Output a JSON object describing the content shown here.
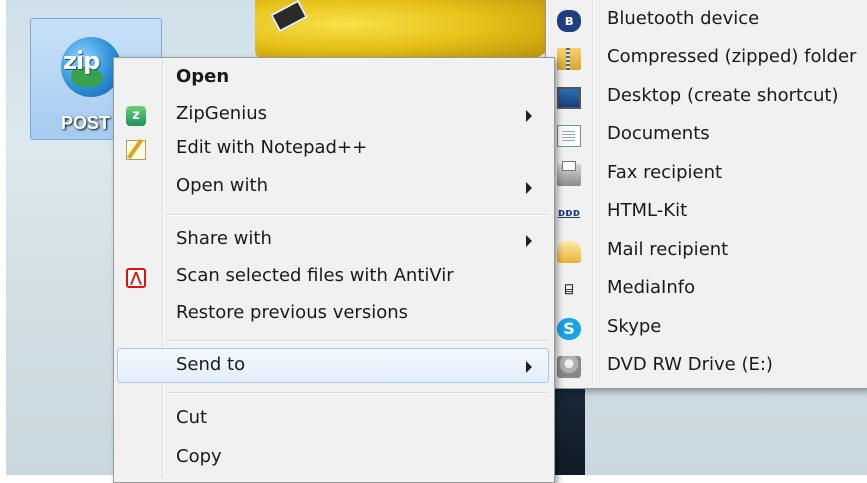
{
  "desktop": {
    "icon_label": "POST",
    "icon_badge": "zip"
  },
  "context_menu": {
    "items": [
      {
        "label": "Open",
        "icon": "",
        "has_submenu": false,
        "bold": true
      },
      {
        "label": "ZipGenius",
        "icon": "zipgenius-icon",
        "has_submenu": true
      },
      {
        "label": "Edit with Notepad++",
        "icon": "notepad-plus-plus-icon",
        "has_submenu": false
      },
      {
        "label": "Open with",
        "icon": "",
        "has_submenu": true
      },
      {
        "label": "Share with",
        "icon": "",
        "has_submenu": true
      },
      {
        "label": "Scan selected files with AntiVir",
        "icon": "antivir-icon",
        "has_submenu": false
      },
      {
        "label": "Restore previous versions",
        "icon": "",
        "has_submenu": false
      },
      {
        "label": "Send to",
        "icon": "",
        "has_submenu": true,
        "highlighted": true
      },
      {
        "label": "Cut",
        "icon": "",
        "has_submenu": false
      },
      {
        "label": "Copy",
        "icon": "",
        "has_submenu": false
      }
    ]
  },
  "send_to_menu": {
    "items": [
      {
        "label": "Bluetooth device",
        "icon": "bluetooth-icon"
      },
      {
        "label": "Compressed (zipped) folder",
        "icon": "zipped-folder-icon"
      },
      {
        "label": "Desktop (create shortcut)",
        "icon": "desktop-icon"
      },
      {
        "label": "Documents",
        "icon": "documents-icon"
      },
      {
        "label": "Fax recipient",
        "icon": "fax-icon"
      },
      {
        "label": "HTML-Kit",
        "icon": "html-kit-icon"
      },
      {
        "label": "Mail recipient",
        "icon": "mail-icon"
      },
      {
        "label": "MediaInfo",
        "icon": "mediainfo-icon"
      },
      {
        "label": "Skype",
        "icon": "skype-icon"
      },
      {
        "label": "DVD RW Drive (E:)",
        "icon": "dvd-drive-icon"
      }
    ]
  },
  "colors": {
    "menu_background": "#f1f1f1",
    "highlight_border": "#a9c8ee",
    "highlight_fill": "#e4eefb",
    "antivir_red": "#e01010",
    "skype_blue": "#1aa3e8"
  }
}
